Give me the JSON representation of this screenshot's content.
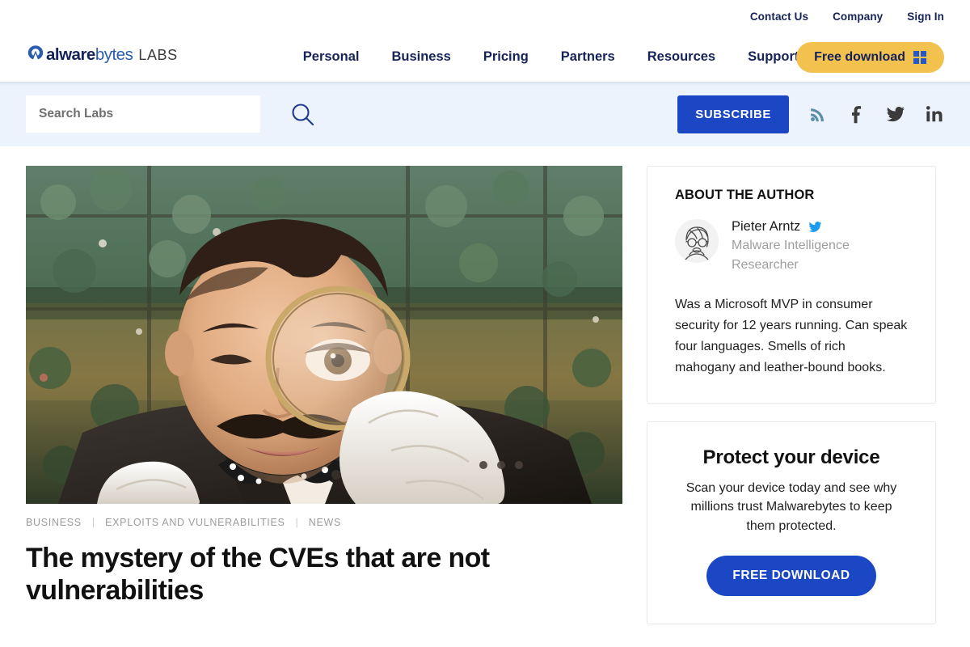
{
  "utility_nav": {
    "items": [
      {
        "label": "Contact Us",
        "name": "contact-us"
      },
      {
        "label": "Company",
        "name": "company"
      },
      {
        "label": "Sign In",
        "name": "sign-in"
      }
    ]
  },
  "brand": {
    "name_part_1": "alware",
    "name_part_2": "bytes",
    "suffix": "LABS"
  },
  "main_nav": {
    "items": [
      {
        "label": "Personal"
      },
      {
        "label": "Business"
      },
      {
        "label": "Pricing"
      },
      {
        "label": "Partners"
      },
      {
        "label": "Resources"
      },
      {
        "label": "Support"
      }
    ]
  },
  "header_cta": {
    "label": "Free download",
    "icon": "windows-icon",
    "bg_color": "#f2c14e",
    "text_color": "#16225a"
  },
  "search": {
    "placeholder": "Search Labs",
    "value": "",
    "icon": "search-icon",
    "bar_bg": "#ecf3fd"
  },
  "subscribe": {
    "label": "SUBSCRIBE",
    "bg_color": "#1b47c4"
  },
  "social": {
    "items": [
      {
        "name": "rss-icon",
        "label": "RSS",
        "color": "#5b8ca8"
      },
      {
        "name": "facebook-icon",
        "label": "Facebook",
        "color": "#3b3b3b"
      },
      {
        "name": "twitter-icon",
        "label": "Twitter",
        "color": "#3b3b3b"
      },
      {
        "name": "linkedin-icon",
        "label": "LinkedIn",
        "color": "#3b3b3b"
      }
    ]
  },
  "article": {
    "categories": [
      {
        "label": "BUSINESS"
      },
      {
        "label": "EXPLOITS AND VULNERABILITIES"
      },
      {
        "label": "NEWS"
      }
    ],
    "category_separator": "|",
    "title": "The mystery of the CVEs that are not vulnerabilities",
    "hero_image_alt": "Detective with magnifying glass over his eye in a garden"
  },
  "sidebar": {
    "author_card": {
      "heading": "ABOUT THE AUTHOR",
      "name": "Pieter Arntz",
      "twitter_icon": "twitter-icon",
      "role": "Malware Intelligence Researcher",
      "bio": "Was a Microsoft MVP in consumer security for 12 years running. Can speak four languages. Smells of rich mahogany and leather-bound books.",
      "avatar_alt": "Sketched portrait of a man with glasses and a moustache"
    },
    "promo_card": {
      "title": "Protect your device",
      "text": "Scan your device today and see why millions trust Malwarebytes to keep them protected.",
      "button_label": "FREE DOWNLOAD",
      "button_color": "#1b47c4"
    }
  }
}
